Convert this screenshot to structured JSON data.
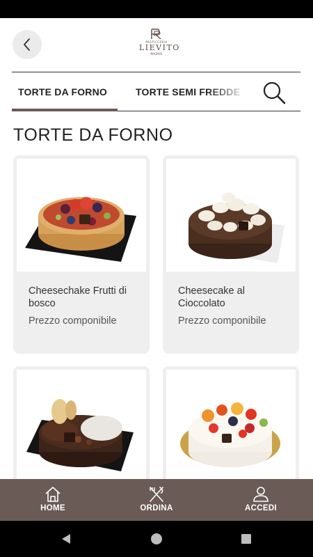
{
  "header": {
    "logo_small": "PASTICCERIA",
    "logo_name": "LIEVITO",
    "logo_sub": "MADRE"
  },
  "tabs": [
    {
      "label": "TORTE DA FORNO",
      "active": true
    },
    {
      "label": "TORTE SEMI FREDDE",
      "active": false
    }
  ],
  "section_title": "TORTE DA FORNO",
  "products": [
    {
      "name": "Cheesechake Frutti di bosco",
      "price": "Prezzo componibile"
    },
    {
      "name": "Cheesecake al Cioccolato",
      "price": "Prezzo componibile"
    },
    {
      "name": "",
      "price": ""
    },
    {
      "name": "",
      "price": ""
    }
  ],
  "bottom_nav": [
    {
      "label": "HOME",
      "icon": "home-icon"
    },
    {
      "label": "ORDINA",
      "icon": "fork-knife-icon"
    },
    {
      "label": "ACCEDI",
      "icon": "user-icon"
    }
  ],
  "colors": {
    "brand": "#6b5b56",
    "card_bg": "#efefef",
    "back_button_bg": "#ebebeb"
  }
}
